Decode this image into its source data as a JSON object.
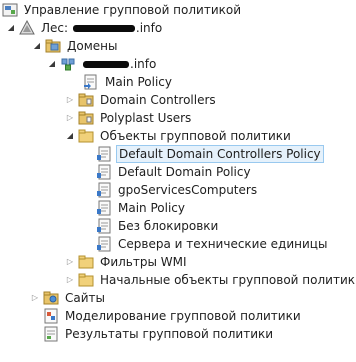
{
  "tree": {
    "root": "Управление групповой политикой",
    "forest_prefix": "Лес:",
    "forest_suffix": ".info",
    "domains": "Домены",
    "domain_suffix": ".info",
    "main_policy": "Main Policy",
    "domain_controllers": "Domain Controllers",
    "polyplast_users": "Polyplast Users",
    "gpo_container": "Объекты групповой политики",
    "gpo_items": [
      "Default Domain Controllers Policy",
      "Default Domain Policy",
      "gpoServicesComputers",
      "Main Policy",
      "Без блокировки",
      "Сервера и технические единицы"
    ],
    "wmi_filters": "Фильтры WMI",
    "starter_gpos": "Начальные объекты групповой политики",
    "sites": "Сайты",
    "modeling": "Моделирование групповой политики",
    "results": "Результаты групповой политики"
  },
  "colors": {
    "selection_bg": "#e5f1fb",
    "selection_border": "#99c9ef",
    "folder": "#e8c46a",
    "ou": "#d9b45a"
  }
}
